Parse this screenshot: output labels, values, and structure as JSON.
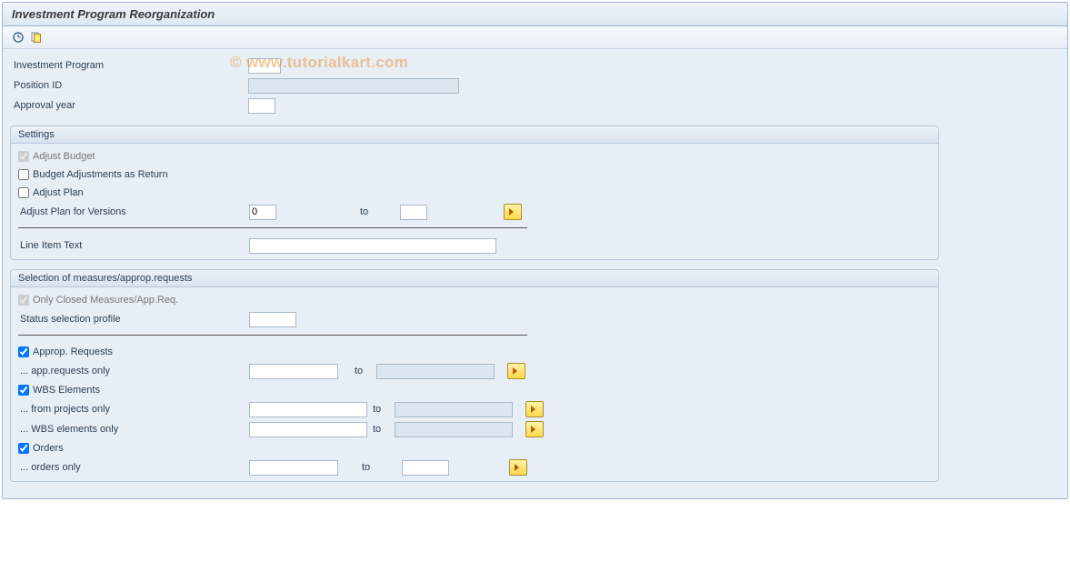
{
  "page": {
    "title": "Investment Program Reorganization",
    "watermark": "© www.tutorialkart.com"
  },
  "toolbar": {
    "execute_icon": "execute",
    "variant_icon": "get-variant"
  },
  "fields": {
    "investment_program_label": "Investment Program",
    "investment_program_value": "",
    "position_id_label": "Position ID",
    "position_id_value": "",
    "approval_year_label": "Approval year",
    "approval_year_value": ""
  },
  "settings": {
    "title": "Settings",
    "adjust_budget_label": "Adjust Budget",
    "adjust_budget_checked": true,
    "budget_adj_return_label": "Budget Adjustments as Return",
    "budget_adj_return_checked": false,
    "adjust_plan_label": "Adjust Plan",
    "adjust_plan_checked": false,
    "adjust_plan_versions_label": "Adjust Plan for Versions",
    "adjust_plan_versions_from": "0",
    "adjust_plan_versions_to": "",
    "to_label": "to",
    "line_item_text_label": "Line Item Text",
    "line_item_text_value": ""
  },
  "selection": {
    "title": "Selection of measures/approp.requests",
    "only_closed_label": "Only Closed Measures/App.Req.",
    "only_closed_checked": true,
    "status_profile_label": "Status selection profile",
    "status_profile_value": "",
    "approp_requests_label": "Approp. Requests",
    "approp_requests_checked": true,
    "app_requests_only_label": "... app.requests only",
    "app_requests_from": "",
    "app_requests_to": "",
    "wbs_elements_label": "WBS Elements",
    "wbs_elements_checked": true,
    "from_projects_label": "... from projects only",
    "from_projects_from": "",
    "from_projects_to": "",
    "wbs_only_label": "... WBS elements only",
    "wbs_only_from": "",
    "wbs_only_to": "",
    "orders_label": "Orders",
    "orders_checked": true,
    "orders_only_label": "... orders only",
    "orders_only_from": "",
    "orders_only_to": "",
    "to_label": "to"
  }
}
